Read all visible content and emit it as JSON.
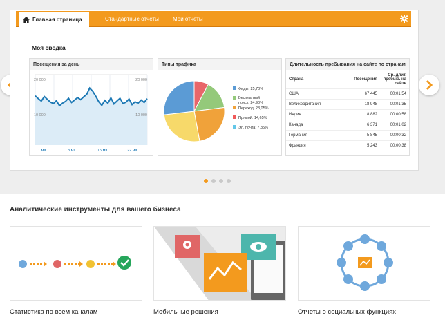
{
  "nav": {
    "home_label": "Главная страница",
    "tab_standard": "Стандартные отчеты",
    "tab_my": "Мои отчеты",
    "home_icon": "home-icon",
    "settings_icon": "gear-icon"
  },
  "summary": {
    "title": "Моя сводка"
  },
  "visits_panel": {
    "title": "Посещения за день",
    "y_top_left": "20 000",
    "y_top_right": "20 000",
    "y_mid_left": "10 000",
    "y_mid_right": "10 000",
    "x_labels": [
      "1 мя",
      "8 мя",
      "15 мя",
      "22 мя"
    ],
    "chart_data": {
      "type": "area",
      "title": "Посещения за день",
      "ylim": [
        0,
        20000
      ],
      "series": [
        {
          "values": [
            14000,
            13200,
            12500,
            13800,
            13000,
            12200,
            11800,
            12600,
            11200,
            11900,
            12400,
            13300,
            12100,
            12800,
            13500,
            12900,
            13700,
            14400,
            16200,
            15300,
            13900,
            12300,
            11300,
            12700,
            11900,
            13400,
            11700,
            12500,
            13300,
            11800,
            12200,
            13100,
            11500,
            12300,
            11900,
            12800,
            12100,
            13200
          ]
        }
      ],
      "grid": true
    }
  },
  "traffic_panel": {
    "title": "Типы трафика",
    "chart_data": {
      "type": "pie",
      "slices": [
        {
          "label": "Фиды: 25,70%",
          "value": 25.7,
          "color": "#f0a23a"
        },
        {
          "label": "Бесплатный поиск: 24,90%",
          "value": 24.9,
          "color": "#f7d96a"
        },
        {
          "label": "Переход: 23,05%",
          "value": 23.05,
          "color": "#94c97a"
        },
        {
          "label": "Прямой: 14,65%",
          "value": 14.65,
          "color": "#e8666a"
        },
        {
          "label": "Эл. почта: 7,35%",
          "value": 7.35,
          "color": "#5b9bd5"
        }
      ]
    },
    "legend": [
      {
        "text": "Фиды: 25,70%",
        "color": "#5b9bd5"
      },
      {
        "text": "Бесплатный поиск: 24,90%",
        "color": "#94c97a"
      },
      {
        "text": "Переход: 23,05%",
        "color": "#f0a23a"
      },
      {
        "text": "Прямой: 14,65%",
        "color": "#f05a5a"
      },
      {
        "text": "Эл. почта: 7,35%",
        "color": "#63c7e8"
      }
    ]
  },
  "duration_panel": {
    "title": "Длительность пребывания на сайте по странам",
    "headers": [
      "Страна",
      "Посещения",
      "Ср. длит. пребыв. на сайте"
    ],
    "rows": [
      [
        "США",
        "67 445",
        "00:01:54"
      ],
      [
        "Великобритания",
        "18 948",
        "00:01:35"
      ],
      [
        "Индия",
        "8 882",
        "00:00:58"
      ],
      [
        "Канада",
        "6 371",
        "00:01:02"
      ],
      [
        "Германия",
        "5 845",
        "00:00:32"
      ],
      [
        "Франция",
        "5 243",
        "00:00:38"
      ]
    ]
  },
  "carousel": {
    "dots": 4,
    "active": 0
  },
  "tools": {
    "title": "Аналитические инструменты для вашего бизнеса",
    "cards": [
      {
        "label": "Статистика по всем каналам"
      },
      {
        "label": "Мобильные решения"
      },
      {
        "label": "Отчеты о социальных функциях"
      }
    ]
  },
  "colors": {
    "accent": "#f39a1e",
    "blue": "#1c78b4",
    "green": "#26a65b"
  }
}
